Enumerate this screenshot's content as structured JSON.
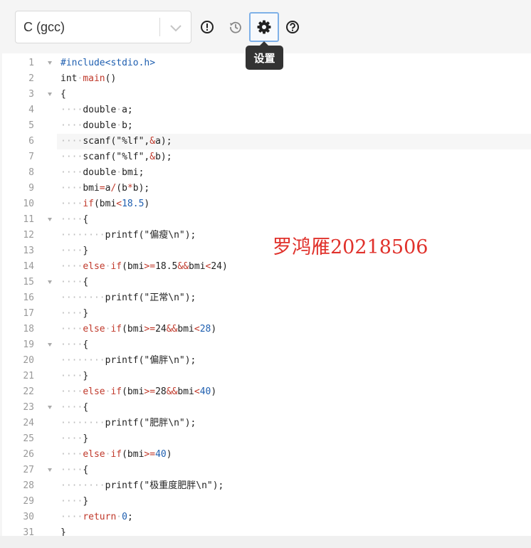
{
  "toolbar": {
    "language_selected": "C (gcc)",
    "icons": [
      "info-icon",
      "history-icon",
      "gear-icon",
      "help-icon"
    ],
    "settings_tooltip": "设置"
  },
  "watermark": "罗鸿雁20218506",
  "colors": {
    "keyword": "#c0392b",
    "number": "#1f5fb0",
    "accent_border": "#7fb1e8",
    "tooltip_bg": "#333333"
  },
  "editor": {
    "active_line": 6,
    "fold_lines": [
      1,
      3,
      11,
      15,
      19,
      23,
      27
    ],
    "lines": [
      {
        "n": "1",
        "indent": 0,
        "tokens": [
          [
            "pre",
            "#include<stdio.h>"
          ]
        ]
      },
      {
        "n": "2",
        "indent": 0,
        "tokens": [
          [
            "",
            "int"
          ],
          [
            "sp",
            "·"
          ],
          [
            "kw",
            "main"
          ],
          [
            "",
            "()"
          ]
        ]
      },
      {
        "n": "3",
        "indent": 0,
        "tokens": [
          [
            "",
            "{"
          ]
        ]
      },
      {
        "n": "4",
        "indent": 1,
        "tokens": [
          [
            "",
            "double"
          ],
          [
            "sp",
            "·"
          ],
          [
            "",
            "a;"
          ]
        ]
      },
      {
        "n": "5",
        "indent": 1,
        "tokens": [
          [
            "",
            "double"
          ],
          [
            "sp",
            "·"
          ],
          [
            "",
            "b;"
          ]
        ]
      },
      {
        "n": "6",
        "indent": 1,
        "tokens": [
          [
            "",
            "scanf(\"%lf\","
          ],
          [
            "op",
            "&"
          ],
          [
            "",
            "a);"
          ]
        ]
      },
      {
        "n": "7",
        "indent": 1,
        "tokens": [
          [
            "",
            "scanf(\"%lf\","
          ],
          [
            "op",
            "&"
          ],
          [
            "",
            "b);"
          ]
        ]
      },
      {
        "n": "8",
        "indent": 1,
        "tokens": [
          [
            "",
            "double"
          ],
          [
            "sp",
            "·"
          ],
          [
            "",
            "bmi;"
          ]
        ]
      },
      {
        "n": "9",
        "indent": 1,
        "tokens": [
          [
            "",
            "bmi"
          ],
          [
            "op",
            "="
          ],
          [
            "",
            "a"
          ],
          [
            "op",
            "/"
          ],
          [
            "",
            "(b"
          ],
          [
            "op",
            "*"
          ],
          [
            "",
            "b);"
          ]
        ]
      },
      {
        "n": "10",
        "indent": 1,
        "tokens": [
          [
            "kw",
            "if"
          ],
          [
            "",
            "(bmi"
          ],
          [
            "op",
            "<"
          ],
          [
            "num",
            "18.5"
          ],
          [
            "",
            ")"
          ]
        ]
      },
      {
        "n": "11",
        "indent": 1,
        "tokens": [
          [
            "",
            "{"
          ]
        ]
      },
      {
        "n": "12",
        "indent": 2,
        "tokens": [
          [
            "",
            "printf(\"偏瘦\\n\");"
          ]
        ]
      },
      {
        "n": "13",
        "indent": 1,
        "tokens": [
          [
            "",
            "}"
          ]
        ]
      },
      {
        "n": "14",
        "indent": 1,
        "tokens": [
          [
            "kw",
            "else"
          ],
          [
            "sp",
            "·"
          ],
          [
            "kw",
            "if"
          ],
          [
            "",
            "(bmi"
          ],
          [
            "op",
            ">="
          ],
          [
            "",
            "18.5"
          ],
          [
            "op",
            "&&"
          ],
          [
            "",
            "bmi"
          ],
          [
            "op",
            "<"
          ],
          [
            "",
            "24)"
          ]
        ]
      },
      {
        "n": "15",
        "indent": 1,
        "tokens": [
          [
            "",
            "{"
          ]
        ]
      },
      {
        "n": "16",
        "indent": 2,
        "tokens": [
          [
            "",
            "printf(\"正常\\n\");"
          ]
        ]
      },
      {
        "n": "17",
        "indent": 1,
        "tokens": [
          [
            "",
            "}"
          ]
        ]
      },
      {
        "n": "18",
        "indent": 1,
        "tokens": [
          [
            "kw",
            "else"
          ],
          [
            "sp",
            "·"
          ],
          [
            "kw",
            "if"
          ],
          [
            "",
            "(bmi"
          ],
          [
            "op",
            ">="
          ],
          [
            "",
            "24"
          ],
          [
            "op",
            "&&"
          ],
          [
            "",
            "bmi"
          ],
          [
            "op",
            "<"
          ],
          [
            "num",
            "28"
          ],
          [
            "",
            ")"
          ]
        ]
      },
      {
        "n": "19",
        "indent": 1,
        "tokens": [
          [
            "",
            "{"
          ]
        ]
      },
      {
        "n": "20",
        "indent": 2,
        "tokens": [
          [
            "",
            "printf(\"偏胖\\n\");"
          ]
        ]
      },
      {
        "n": "21",
        "indent": 1,
        "tokens": [
          [
            "",
            "}"
          ]
        ]
      },
      {
        "n": "22",
        "indent": 1,
        "tokens": [
          [
            "kw",
            "else"
          ],
          [
            "sp",
            "·"
          ],
          [
            "kw",
            "if"
          ],
          [
            "",
            "(bmi"
          ],
          [
            "op",
            ">="
          ],
          [
            "",
            "28"
          ],
          [
            "op",
            "&&"
          ],
          [
            "",
            "bmi"
          ],
          [
            "op",
            "<"
          ],
          [
            "num",
            "40"
          ],
          [
            "",
            ")"
          ]
        ]
      },
      {
        "n": "23",
        "indent": 1,
        "tokens": [
          [
            "",
            "{"
          ]
        ]
      },
      {
        "n": "24",
        "indent": 2,
        "tokens": [
          [
            "",
            "printf(\"肥胖\\n\");"
          ]
        ]
      },
      {
        "n": "25",
        "indent": 1,
        "tokens": [
          [
            "",
            "}"
          ]
        ]
      },
      {
        "n": "26",
        "indent": 1,
        "tokens": [
          [
            "kw",
            "else"
          ],
          [
            "sp",
            "·"
          ],
          [
            "kw",
            "if"
          ],
          [
            "",
            "(bmi"
          ],
          [
            "op",
            ">="
          ],
          [
            "num",
            "40"
          ],
          [
            "",
            ")"
          ]
        ]
      },
      {
        "n": "27",
        "indent": 1,
        "tokens": [
          [
            "",
            "{"
          ]
        ]
      },
      {
        "n": "28",
        "indent": 2,
        "tokens": [
          [
            "",
            "printf(\"极重度肥胖\\n\");"
          ]
        ]
      },
      {
        "n": "29",
        "indent": 1,
        "tokens": [
          [
            "",
            "}"
          ]
        ]
      },
      {
        "n": "30",
        "indent": 1,
        "tokens": [
          [
            "kw",
            "return"
          ],
          [
            "sp",
            "·"
          ],
          [
            "num",
            "0"
          ],
          [
            "",
            ";"
          ]
        ]
      },
      {
        "n": "31",
        "indent": 0,
        "tokens": [
          [
            "",
            "}"
          ]
        ]
      }
    ]
  }
}
